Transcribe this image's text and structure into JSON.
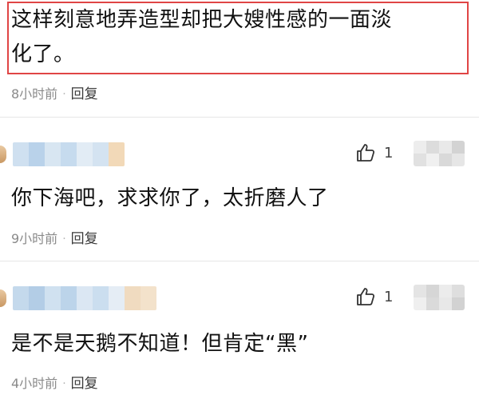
{
  "highlighted_comment": {
    "line1": "这样刻意地弄造型却把大嫂性感的一面淡",
    "line2": "化了。",
    "time": "8小时前",
    "separator": "·",
    "reply_label": "回复"
  },
  "comments": [
    {
      "text": "你下海吧，求求你了，太折磨人了",
      "time": "9小时前",
      "separator": "·",
      "reply_label": "回复",
      "like_count": "1",
      "username_blurred": true
    },
    {
      "text": "是不是天鹅不知道！但肯定“黑”",
      "time": "4小时前",
      "separator": "·",
      "reply_label": "回复",
      "like_count": "1",
      "username_blurred": true
    }
  ],
  "icons": {
    "like": "thumbs-up-icon"
  },
  "colors": {
    "highlight_border": "#e04545",
    "meta_text": "#8a8a8a",
    "body_text": "#111111"
  }
}
